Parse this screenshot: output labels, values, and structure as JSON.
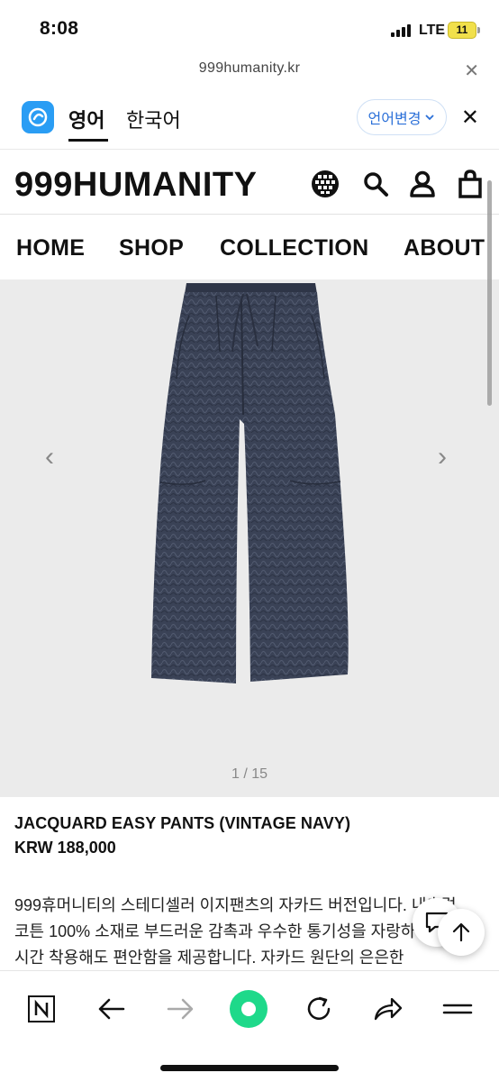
{
  "status": {
    "time": "8:08",
    "network": "LTE",
    "battery": "11"
  },
  "browser": {
    "url": "999humanity.kr",
    "close_glyph": "✕"
  },
  "translate": {
    "tab_active": "영어",
    "tab_inactive": "한국어",
    "language_button": "언어변경",
    "close_glyph": "✕"
  },
  "site": {
    "logo": "999HUMANITY",
    "icons": [
      "globe-icon",
      "search-icon",
      "user-icon",
      "bag-icon"
    ],
    "nav": [
      "HOME",
      "SHOP",
      "COLLECTION",
      "ABOUT"
    ]
  },
  "gallery": {
    "counter": "1 / 15",
    "prev_glyph": "‹",
    "next_glyph": "›"
  },
  "product": {
    "name": "JACQUARD EASY PANTS (VINTAGE NAVY)",
    "price": "KRW 188,000",
    "description": [
      "999휴머니티의 스테디셀러 이지팬츠의 자카드 버전입니다. 내추럴",
      "코튼 100% 소재로 부드러운 감촉과 우수한 통기성을 자랑하여 장",
      "시간 착용해도 편안함을 제공합니다. 자카드 원단의 은은한"
    ]
  },
  "colors": {
    "accent_blue": "#2a6fd8",
    "papago_blue": "#2a9df4",
    "reload_green": "#1ed98a",
    "pants_navy": "#3a4256"
  },
  "toolbar": {
    "icons": [
      "naver-icon",
      "back-icon",
      "forward-icon",
      "home-dot-icon",
      "reload-icon",
      "share-icon",
      "menu-icon"
    ]
  }
}
